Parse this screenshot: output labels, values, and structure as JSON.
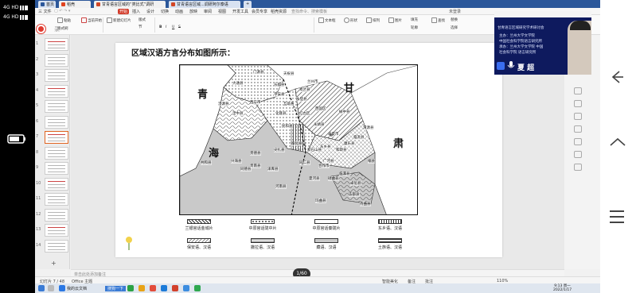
{
  "phone": {
    "net_top": "4G HD",
    "net_bottom": "4G HD"
  },
  "tabs": [
    {
      "label": "首页",
      "color": "#2b579a"
    },
    {
      "label": "稻壳",
      "color": "#e0431f"
    },
    {
      "label": "甘青语言区域的“类比式”调研",
      "color": "#d24726"
    },
    {
      "label": "甘青语言区域...调研阿尔泰语",
      "color": "#d24726"
    }
  ],
  "menu": {
    "file_label": "三 文件",
    "items": [
      "开始",
      "插入",
      "设计",
      "切换",
      "动画",
      "放映",
      "审阅",
      "视图",
      "开发工具",
      "会员专享",
      "稻壳资源"
    ],
    "active_index": 0,
    "search_placeholder": "查找命令、搜索模板",
    "share_label": "分享",
    "account_label": "未登录"
  },
  "ribbon": {
    "tools": [
      "粘贴",
      "格式刷",
      "当前开始",
      "新建幻灯片",
      "版式",
      "节",
      "重置",
      "B",
      "I",
      "U",
      "S",
      "文本框",
      "形状",
      "排列",
      "图片",
      "填充",
      "轮廓",
      "查找",
      "替换",
      "选择"
    ]
  },
  "recording": {
    "label": "录"
  },
  "thumbnails": {
    "numbers": [
      "1",
      "2",
      "3",
      "4",
      "5",
      "6",
      "7",
      "8",
      "9",
      "10",
      "11",
      "12",
      "13",
      "14"
    ],
    "selected_index": 6,
    "add_label": "+"
  },
  "slide": {
    "title": "区域汉语方言分布如图所示：",
    "map": {
      "big_labels": [
        "青",
        "甘",
        "海",
        "肃"
      ],
      "places": [
        "门源县",
        "大通县",
        "乐都县",
        "西宁市",
        "平安县",
        "湟中县",
        "湟源县",
        "化隆县",
        "循化县",
        "同仁县",
        "贵德县",
        "尖扎县",
        "泽库县",
        "河南县",
        "同德县",
        "兴海县",
        "贵南县",
        "共和县",
        "东乡县",
        "临夏市",
        "积石山县",
        "和政县",
        "康乐县",
        "广河县",
        "永靖县",
        "临洮县",
        "渭源县",
        "卓尼县",
        "临潭县",
        "夏河县",
        "碌曲县",
        "合作市",
        "岷县",
        "兰州市",
        "永登县",
        "天祝县",
        "民和县",
        "互助县",
        "红古区",
        "西固区",
        "皋兰县",
        "榆中县",
        "舟曲县",
        "迭部县",
        "玛曲县"
      ]
    },
    "legend": [
      {
        "label": "兰银官话金城片"
      },
      {
        "label": "中原官话陇中片"
      },
      {
        "label": "中原官话秦陇片"
      },
      {
        "label": "东乡语、汉语"
      },
      {
        "label": "保安语、汉语"
      },
      {
        "label": "撒拉语、汉语"
      },
      {
        "label": "藏语、汉语"
      },
      {
        "label": "土族语、汉语"
      }
    ]
  },
  "notes": {
    "placeholder": "单击此处添加备注"
  },
  "page_indicator": "1/60",
  "video": {
    "line1": "甘青语言区域研究学术研讨会",
    "line2": "主办：兰州大学文学院",
    "line3": "中国社会科学院语言研究所",
    "line4": "承办：兰州大学文学院 中国",
    "line5": "社会科学院 语言研究所",
    "speaker": "夏 超"
  },
  "statusbar": {
    "slide_info": "幻灯片 7 / 48",
    "theme": "Office 主题",
    "notes_toggle": "智能美化",
    "notes2": "备注",
    "comments": "批注",
    "zoom": "110%"
  },
  "taskbar": {
    "items": [
      "开始",
      "我的云文档",
      "搜狗一下"
    ],
    "time": "9:13 周一",
    "date": "2022/1/17"
  }
}
